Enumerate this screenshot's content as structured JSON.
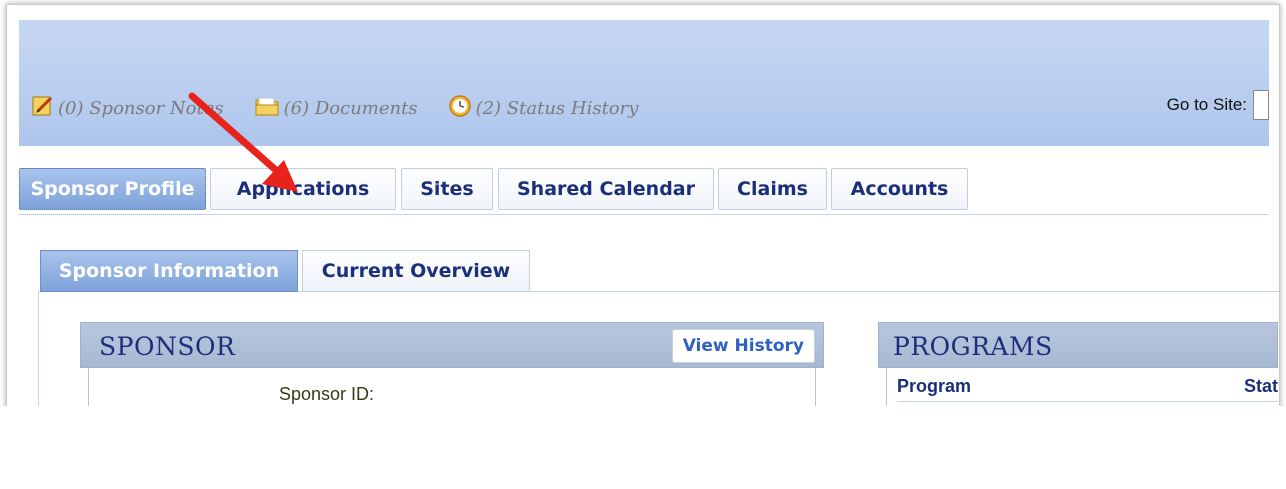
{
  "header": {
    "actions": [
      {
        "label": "(0) Sponsor Notes",
        "icon": "notes-edit-icon"
      },
      {
        "label": "(6) Documents",
        "icon": "folder-icon"
      },
      {
        "label": "(2) Status History",
        "icon": "clock-icon"
      }
    ],
    "go_to_site_label": "Go to Site:"
  },
  "main_tabs": [
    {
      "label": "Sponsor Profile",
      "active": true
    },
    {
      "label": "Applications",
      "active": false
    },
    {
      "label": "Sites",
      "active": false
    },
    {
      "label": "Shared Calendar",
      "active": false
    },
    {
      "label": "Claims",
      "active": false
    },
    {
      "label": "Accounts",
      "active": false
    }
  ],
  "sub_tabs": [
    {
      "label": "Sponsor Information",
      "active": true
    },
    {
      "label": "Current Overview",
      "active": false
    }
  ],
  "sponsor_section": {
    "title": "SPONSOR",
    "view_history_label": "View History",
    "sponsor_id_label": "Sponsor ID:"
  },
  "programs_section": {
    "title": "PROGRAMS",
    "columns": [
      "Program",
      "Stat"
    ]
  },
  "colors": {
    "banner": "#b8cdef",
    "tab_text": "#1c2f7a",
    "active_tab": "#7da2d9",
    "arrow": "#e8231c",
    "link_blue": "#2f62c0"
  }
}
